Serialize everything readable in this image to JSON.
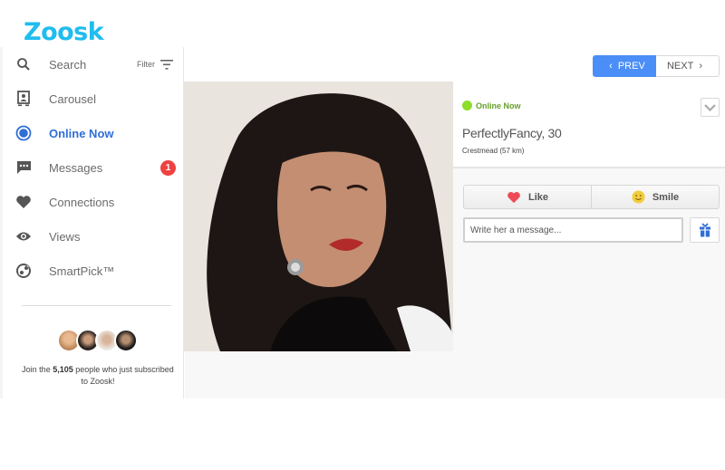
{
  "brand": {
    "logo_text": "Zoosk",
    "color": "#1fbdee"
  },
  "sidebar": {
    "filter_label": "Filter",
    "items": [
      {
        "label": "Search",
        "icon": "search-icon"
      },
      {
        "label": "Carousel",
        "icon": "carousel-icon"
      },
      {
        "label": "Online Now",
        "icon": "online-now-icon",
        "active": true
      },
      {
        "label": "Messages",
        "icon": "messages-icon",
        "badge": "1"
      },
      {
        "label": "Connections",
        "icon": "heart-icon"
      },
      {
        "label": "Views",
        "icon": "eye-icon"
      },
      {
        "label": "SmartPick™",
        "icon": "smartpick-icon"
      }
    ],
    "promo": {
      "prefix": "Join the ",
      "count": "5,105",
      "suffix": " people who just subscribed to Zoosk!"
    }
  },
  "pager": {
    "prev_label": "PREV",
    "next_label": "NEXT"
  },
  "profile": {
    "status": "Online Now",
    "name_age": "PerfectlyFancy, 30",
    "location": "Crestmead (57 km)"
  },
  "actions": {
    "like_label": "Like",
    "smile_label": "Smile",
    "message_placeholder": "Write her a message..."
  },
  "colors": {
    "accent_blue": "#4c8ef7",
    "active_nav": "#2f6fd6",
    "online_green": "#8ddd2a",
    "badge_red": "#ee4242",
    "like_red": "#ee4a55",
    "gift_blue": "#2f6fd6"
  }
}
